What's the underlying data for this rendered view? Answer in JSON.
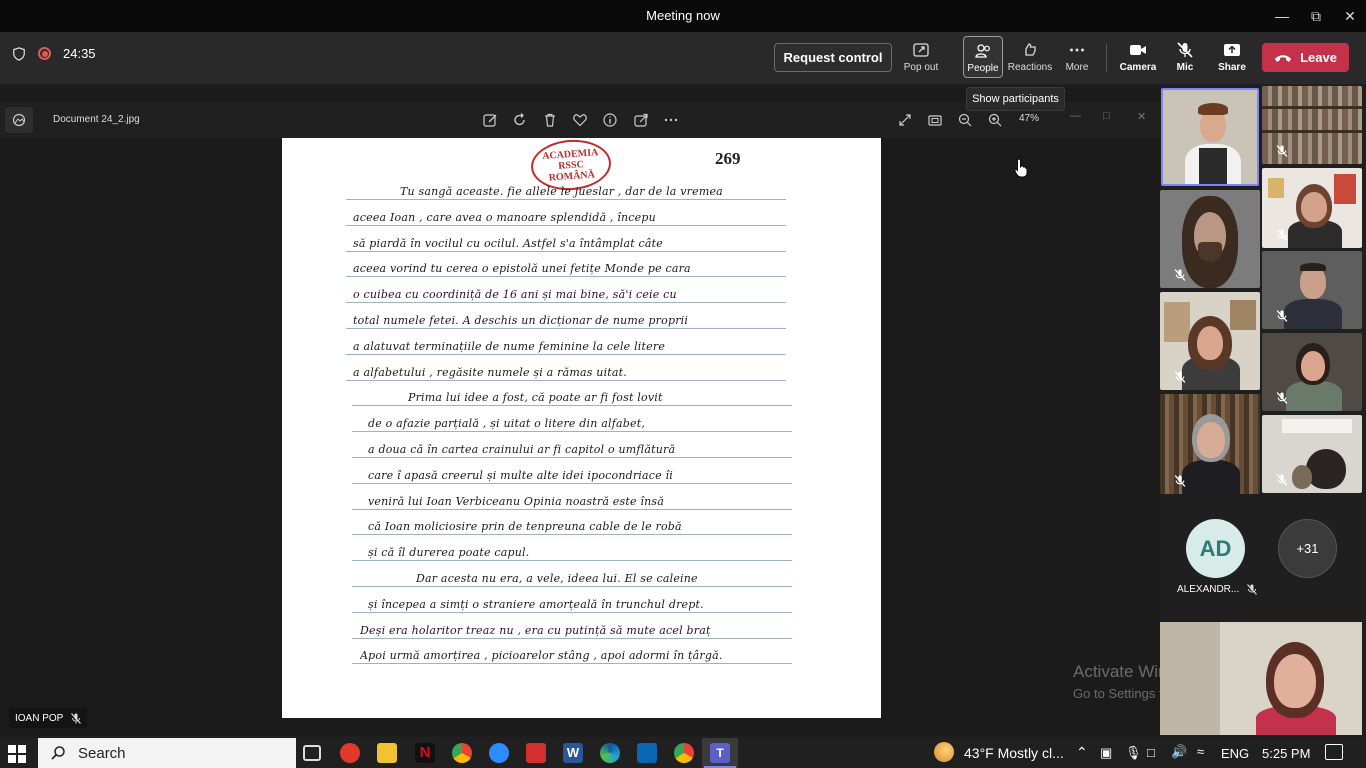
{
  "window": {
    "title": "Meeting now"
  },
  "meeting": {
    "timer": "24:35",
    "request_control": "Request control",
    "buttons": {
      "pop_out": "Pop out",
      "people": "People",
      "reactions": "Reactions",
      "more": "More",
      "camera": "Camera",
      "mic": "Mic",
      "share": "Share",
      "leave": "Leave"
    },
    "tooltip": "Show participants"
  },
  "viewer": {
    "file_name": "Document 24_2.jpg",
    "zoom": "47%"
  },
  "document": {
    "page_number": "269",
    "stamp": [
      "ACADEMIA",
      "RSSC",
      "ROMÂNĂ"
    ],
    "lines": [
      "Tu sangă aceaste. fie allele le jueslar , dar de la vremea",
      "aceea Ioan , care avea o manoare splendidă , începu",
      "să piardă în vocilul cu ocilul. Astfel s'a întâmplat câte",
      "aceea vorind tu cerea o epistolă unei fetițe Monde pe cara",
      "o cuibea cu coordiniță de 16 ani și mai bine, să'i ceie cu",
      "total numele fetei. A deschis un dicționar de nume proprii",
      "a alatuvat terminațiile de nume feminine la cele litere",
      "a alfabetului , regăsite numele și a rămas uitat.",
      "Prima lui idee a fost, că poate ar fi fost lovit",
      "de o afazie parțială , și uitat o litere din alfabet,",
      "a doua că în cartea crainului ar fi capitol o umflătură",
      "care î apasă creerul și multe alte idei ipocondriace îi",
      "veniră lui Ioan Verbiceanu Opinia noastră este însă",
      "că Ioan moliciosire prin de tenpreuna cable de le robă",
      "și că îl durerea poate capul.",
      "Dar acesta nu era, a vele, ideea lui. El se caleine",
      "și începea a simți o straniere amorțeală în trunchul drept.",
      "Deși era holaritor treaz nu , era cu putință să mute acel braț",
      "Apoi urmă amorțirea , picioarelor stâng , apoi adormi în țârgă."
    ]
  },
  "watermark": {
    "line1": "Activate Windows",
    "line2": "Go to Settings to activate Windows."
  },
  "presenter": {
    "name": "IOAN POP"
  },
  "participants": {
    "avatar_initials": "AD",
    "avatar_name": "ALEXANDR...",
    "overflow_count": "+31"
  },
  "taskbar": {
    "search_placeholder": "Search",
    "weather": "43°F  Mostly cl...",
    "language": "ENG",
    "time": "5:25 PM"
  },
  "colors": {
    "leave": "#c4314b",
    "self_border": "#7f85f5",
    "stamp": "#c02a2a"
  }
}
